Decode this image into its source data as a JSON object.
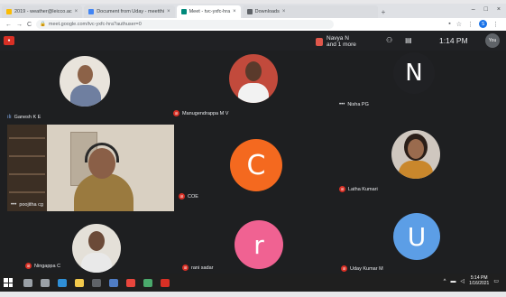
{
  "browser": {
    "tabs": [
      {
        "label": "2019 - weather@leicco.ac",
        "favicon_color": "#fbbc04"
      },
      {
        "label": "Document from Uday - meetthi",
        "favicon_color": "#4285f4"
      },
      {
        "label": "Meet - tvc-yxfc-hra",
        "favicon_color": "#00897b",
        "active": true
      },
      {
        "label": "Downloads",
        "favicon_color": "#5f6368"
      }
    ],
    "url": "meet.google.com/tvc-yxfc-hra?authuser=0",
    "profile_initial": "S"
  },
  "meet": {
    "recording_badge": "●",
    "presenter": {
      "line1": "Navya N",
      "line2": "and 1 more"
    },
    "time": "1:14 PM",
    "you_label": "You"
  },
  "participants": [
    {
      "name": "Ganesh K E",
      "type": "photo",
      "mic": "on"
    },
    {
      "name": "Manugendrappa M V",
      "type": "photo",
      "mic": "off"
    },
    {
      "name": "Nisha PG",
      "type": "letter",
      "letter": "N",
      "color": "#202124",
      "mic": "dots"
    },
    {
      "name": "poojitha cg",
      "type": "video",
      "mic": "dots"
    },
    {
      "name": "COE",
      "type": "letter",
      "letter": "C",
      "color": "#f4691f",
      "mic": "off"
    },
    {
      "name": "Latha Kumari",
      "type": "photo",
      "mic": "off"
    },
    {
      "name": "Ningappa C",
      "type": "photo",
      "mic": "off"
    },
    {
      "name": "rani sadar",
      "type": "letter",
      "letter": "r",
      "color": "#f06292",
      "mic": "off"
    },
    {
      "name": "Uday Kumar M",
      "type": "letter",
      "letter": "U",
      "color": "#5c9ee6",
      "mic": "off"
    }
  ],
  "taskbar": {
    "time": "5:14 PM",
    "date": "1/16/2021"
  }
}
